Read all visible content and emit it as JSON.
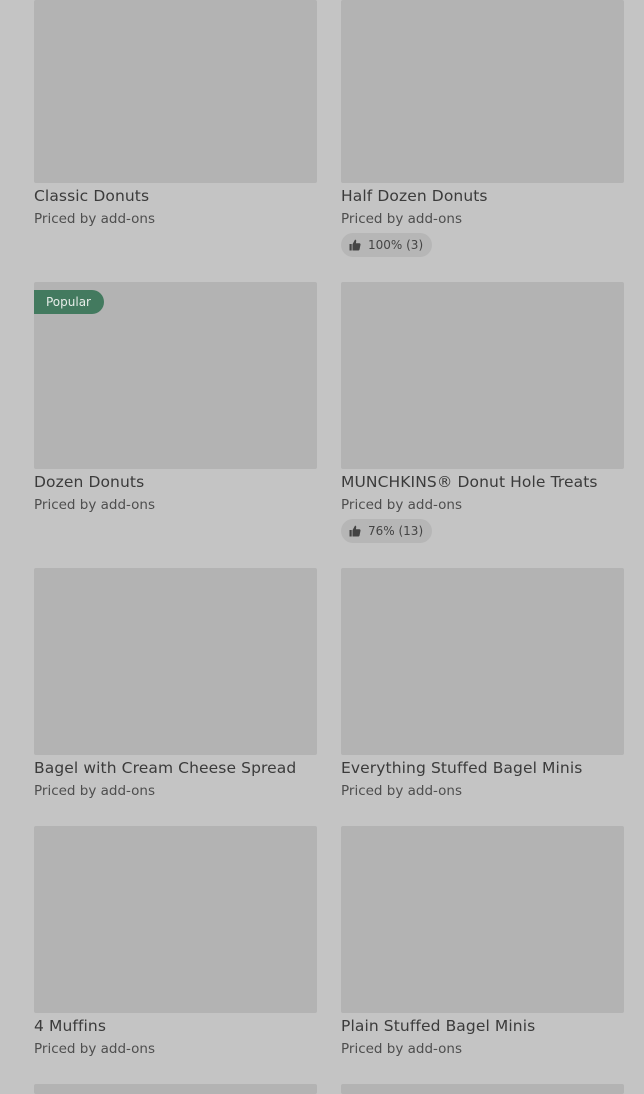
{
  "colors": {
    "page_bg": "#c4c4c4",
    "image_placeholder": "#b3b3b3",
    "popular_badge": "#437a5f",
    "rating_pill": "#b6b6b6"
  },
  "items": [
    {
      "name": "Classic Donuts",
      "price": "Priced by add-ons"
    },
    {
      "name": "Half Dozen Donuts",
      "price": "Priced by add-ons",
      "rating": "100% (3)",
      "rating_icon": "thumbs-up-icon"
    },
    {
      "name": "Dozen Donuts",
      "price": "Priced by add-ons",
      "badge": "Popular"
    },
    {
      "name": "MUNCHKINS® Donut Hole Treats",
      "price": "Priced by add-ons",
      "rating": "76% (13)",
      "rating_icon": "thumbs-up-icon"
    },
    {
      "name": "Bagel with Cream Cheese Spread",
      "price": "Priced by add-ons"
    },
    {
      "name": "Everything Stuffed Bagel Minis",
      "price": "Priced by add-ons"
    },
    {
      "name": "4 Muffins",
      "price": "Priced by add-ons"
    },
    {
      "name": "Plain Stuffed Bagel Minis",
      "price": "Priced by add-ons"
    }
  ]
}
